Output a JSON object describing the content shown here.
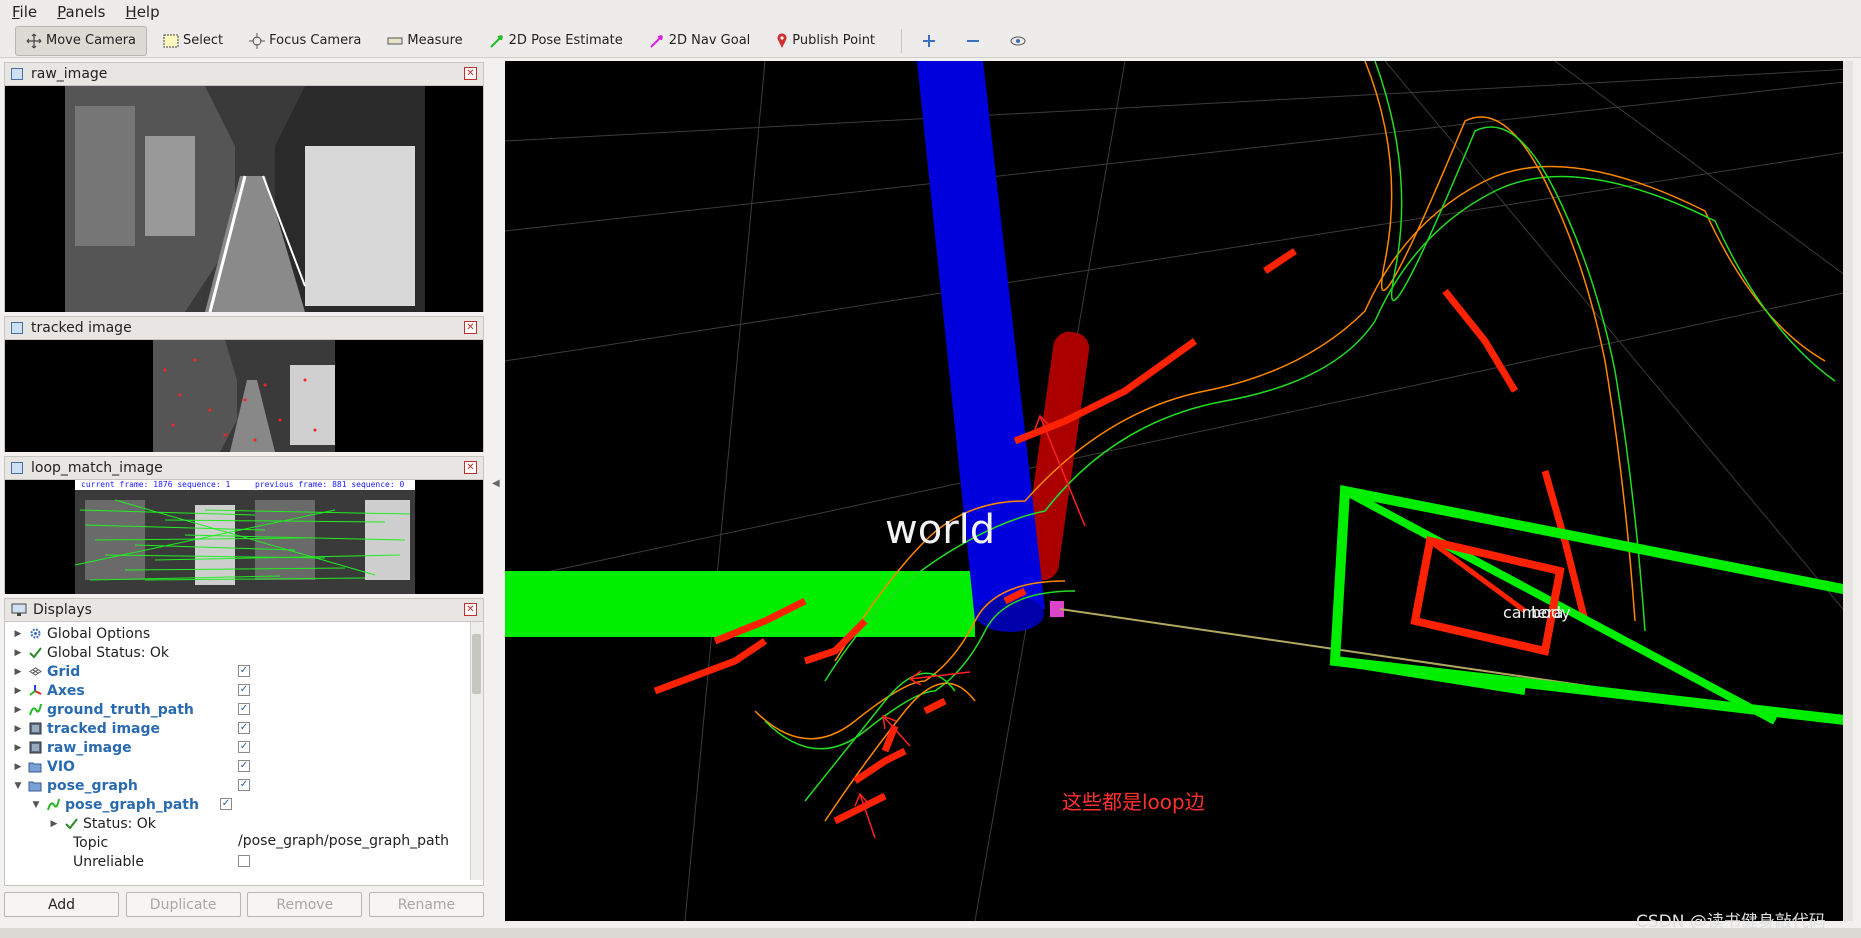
{
  "menu": [
    "File",
    "Panels",
    "Help"
  ],
  "toolbar": [
    {
      "label": "Move Camera",
      "icon": "move-camera-icon",
      "active": true
    },
    {
      "label": "Select",
      "icon": "select-icon"
    },
    {
      "label": "Focus Camera",
      "icon": "focus-camera-icon"
    },
    {
      "label": "Measure",
      "icon": "measure-icon"
    },
    {
      "label": "2D Pose Estimate",
      "icon": "pose-arrow-icon"
    },
    {
      "label": "2D Nav Goal",
      "icon": "nav-goal-arrow-icon"
    },
    {
      "label": "Publish Point",
      "icon": "map-pin-icon"
    }
  ],
  "toolbar_extra_icons": [
    "plus-icon",
    "minus-icon",
    "eye-icon"
  ],
  "panels": {
    "raw_image": {
      "title": "raw_image"
    },
    "tracked_image": {
      "title": "tracked image"
    },
    "loop_match_image": {
      "title": "loop_match_image",
      "overlay_left": "current frame: 1876   sequence: 1",
      "overlay_right": "previous frame: 881   sequence: 0"
    },
    "displays": {
      "title": "Displays"
    }
  },
  "displays_tree": [
    {
      "label": "Global Options",
      "icon": "gear-icon",
      "checked": null,
      "bold": false
    },
    {
      "label": "Global Status: Ok",
      "icon": "check-icon",
      "checked": null,
      "bold": false
    },
    {
      "label": "Grid",
      "icon": "grid-icon",
      "checked": true,
      "bold": true
    },
    {
      "label": "Axes",
      "icon": "axes-icon",
      "checked": true,
      "bold": true
    },
    {
      "label": "ground_truth_path",
      "icon": "path-icon",
      "checked": true,
      "bold": true
    },
    {
      "label": "tracked image",
      "icon": "image-icon",
      "checked": true,
      "bold": true
    },
    {
      "label": "raw_image",
      "icon": "image-icon",
      "checked": true,
      "bold": true
    },
    {
      "label": "VIO",
      "icon": "folder-icon",
      "checked": true,
      "bold": true
    },
    {
      "label": "pose_graph",
      "icon": "folder-icon",
      "checked": true,
      "bold": true
    }
  ],
  "pose_graph_path": {
    "label": "pose_graph_path",
    "status": "Status: Ok",
    "topic_label": "Topic",
    "topic_value": "/pose_graph/pose_graph_path",
    "unreliable_label": "Unreliable"
  },
  "buttons": {
    "add": "Add",
    "duplicate": "Duplicate",
    "remove": "Remove",
    "rename": "Rename"
  },
  "viewport": {
    "frame_world": "world",
    "frame_body": "body",
    "frame_camera": "camera",
    "annotation": "这些都是loop边",
    "watermark": "CSDN @读书健身敲代码"
  },
  "colors": {
    "x_axis": "#00ee00",
    "y_axis": "#cc0000",
    "z_axis": "#0000dd",
    "loop_edge": "#ff2200",
    "vio_path": "#ff8800",
    "gt_path": "#22dd22",
    "annotation": "#ff3030"
  }
}
